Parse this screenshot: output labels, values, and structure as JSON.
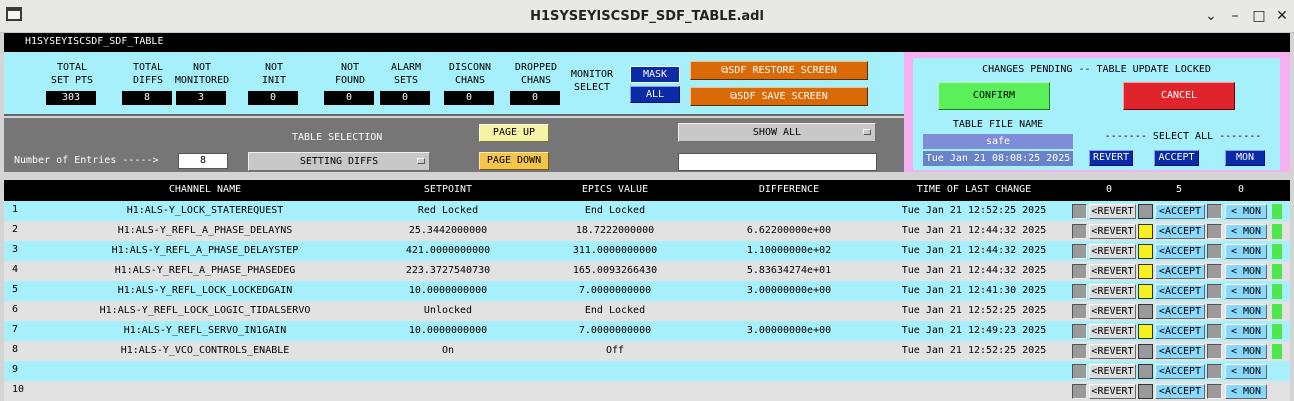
{
  "window": {
    "title": "H1SYSEYISCSDF_SDF_TABLE.adl"
  },
  "screen_name": "H1SYSEYISCSDF_SDF_TABLE",
  "stats": [
    {
      "label": "TOTAL\nSET PTS",
      "value": "303"
    },
    {
      "label": "TOTAL\nDIFFS",
      "value": "8"
    },
    {
      "label": "NOT\nMONITORED",
      "value": "3"
    },
    {
      "label": "NOT\nINIT",
      "value": "0"
    },
    {
      "label": "NOT\nFOUND",
      "value": "0"
    },
    {
      "label": "ALARM\nSETS",
      "value": "0"
    },
    {
      "label": "DISCONN\nCHANS",
      "value": "0"
    },
    {
      "label": "DROPPED\nCHANS",
      "value": "0"
    }
  ],
  "monitor_select": {
    "label": "MONITOR\nSELECT",
    "mask": "MASK",
    "all": "ALL"
  },
  "restore_button": "⧉SDF RESTORE SCREEN",
  "save_button": "⧉SDF SAVE SCREEN",
  "table_selection": {
    "label": "TABLE SELECTION",
    "value": "SETTING DIFFS",
    "entries_label": "Number of Entries ----->",
    "entries_value": "8",
    "page_up": "PAGE UP",
    "page_down": "PAGE DOWN",
    "show_all": "SHOW ALL",
    "filter": ""
  },
  "status_panel": {
    "message": "CHANGES PENDING -- TABLE UPDATE LOCKED",
    "confirm": "CONFIRM",
    "cancel": "CANCEL",
    "file_label": "TABLE FILE NAME",
    "file_name": "safe",
    "file_time": "Tue Jan 21 08:08:25 2025",
    "select_all": "------- SELECT ALL -------",
    "revert": "REVERT",
    "accept": "ACCEPT",
    "mon": "MON"
  },
  "table": {
    "headers": {
      "channel": "CHANNEL NAME",
      "setpoint": "SETPOINT",
      "epics": "EPICS VALUE",
      "difference": "DIFFERENCE",
      "time": "TIME OF LAST CHANGE",
      "revert_count": "0",
      "accept_count": "5",
      "mon_count": "0"
    },
    "button_labels": {
      "revert": "<REVERT",
      "accept": "<ACCEPT",
      "mon": "< MON"
    },
    "accent_colors": {
      "cyan_row": "#a6f0fb",
      "gray_row": "#e2e2e2",
      "yellow": "#f7f020",
      "green": "#4ce84c"
    },
    "rows": [
      {
        "idx": "1",
        "channel": "H1:ALS-Y_LOCK_STATEREQUEST",
        "setpoint": "Red Locked",
        "epics": "End Locked",
        "diff": "",
        "time": "Tue Jan 21 12:52:25 2025",
        "accept_marked": false,
        "green": true
      },
      {
        "idx": "2",
        "channel": "H1:ALS-Y_REFL_A_PHASE_DELAYNS",
        "setpoint": "25.3442000000",
        "epics": "18.7222000000",
        "diff": "6.62200000e+00",
        "time": "Tue Jan 21 12:44:32 2025",
        "accept_marked": true,
        "green": true
      },
      {
        "idx": "3",
        "channel": "H1:ALS-Y_REFL_A_PHASE_DELAYSTEP",
        "setpoint": "421.0000000000",
        "epics": "311.0000000000",
        "diff": "1.10000000e+02",
        "time": "Tue Jan 21 12:44:32 2025",
        "accept_marked": true,
        "green": true
      },
      {
        "idx": "4",
        "channel": "H1:ALS-Y_REFL_A_PHASE_PHASEDEG",
        "setpoint": "223.3727540730",
        "epics": "165.0093266430",
        "diff": "5.83634274e+01",
        "time": "Tue Jan 21 12:44:32 2025",
        "accept_marked": true,
        "green": true
      },
      {
        "idx": "5",
        "channel": "H1:ALS-Y_REFL_LOCK_LOCKEDGAIN",
        "setpoint": "10.0000000000",
        "epics": "7.0000000000",
        "diff": "3.00000000e+00",
        "time": "Tue Jan 21 12:41:30 2025",
        "accept_marked": true,
        "green": true
      },
      {
        "idx": "6",
        "channel": "H1:ALS-Y_REFL_LOCK_LOGIC_TIDALSERVO",
        "setpoint": "Unlocked",
        "epics": "End Locked",
        "diff": "",
        "time": "Tue Jan 21 12:52:25 2025",
        "accept_marked": false,
        "green": true
      },
      {
        "idx": "7",
        "channel": "H1:ALS-Y_REFL_SERVO_IN1GAIN",
        "setpoint": "10.0000000000",
        "epics": "7.0000000000",
        "diff": "3.00000000e+00",
        "time": "Tue Jan 21 12:49:23 2025",
        "accept_marked": true,
        "green": true
      },
      {
        "idx": "8",
        "channel": "H1:ALS-Y_VCO_CONTROLS_ENABLE",
        "setpoint": "On",
        "epics": "Off",
        "diff": "",
        "time": "Tue Jan 21 12:52:25 2025",
        "accept_marked": false,
        "green": true
      },
      {
        "idx": "9",
        "channel": "",
        "setpoint": "",
        "epics": "",
        "diff": "",
        "time": "",
        "accept_marked": false,
        "green": false
      },
      {
        "idx": "10",
        "channel": "",
        "setpoint": "",
        "epics": "",
        "diff": "",
        "time": "",
        "accept_marked": false,
        "green": false
      }
    ]
  }
}
